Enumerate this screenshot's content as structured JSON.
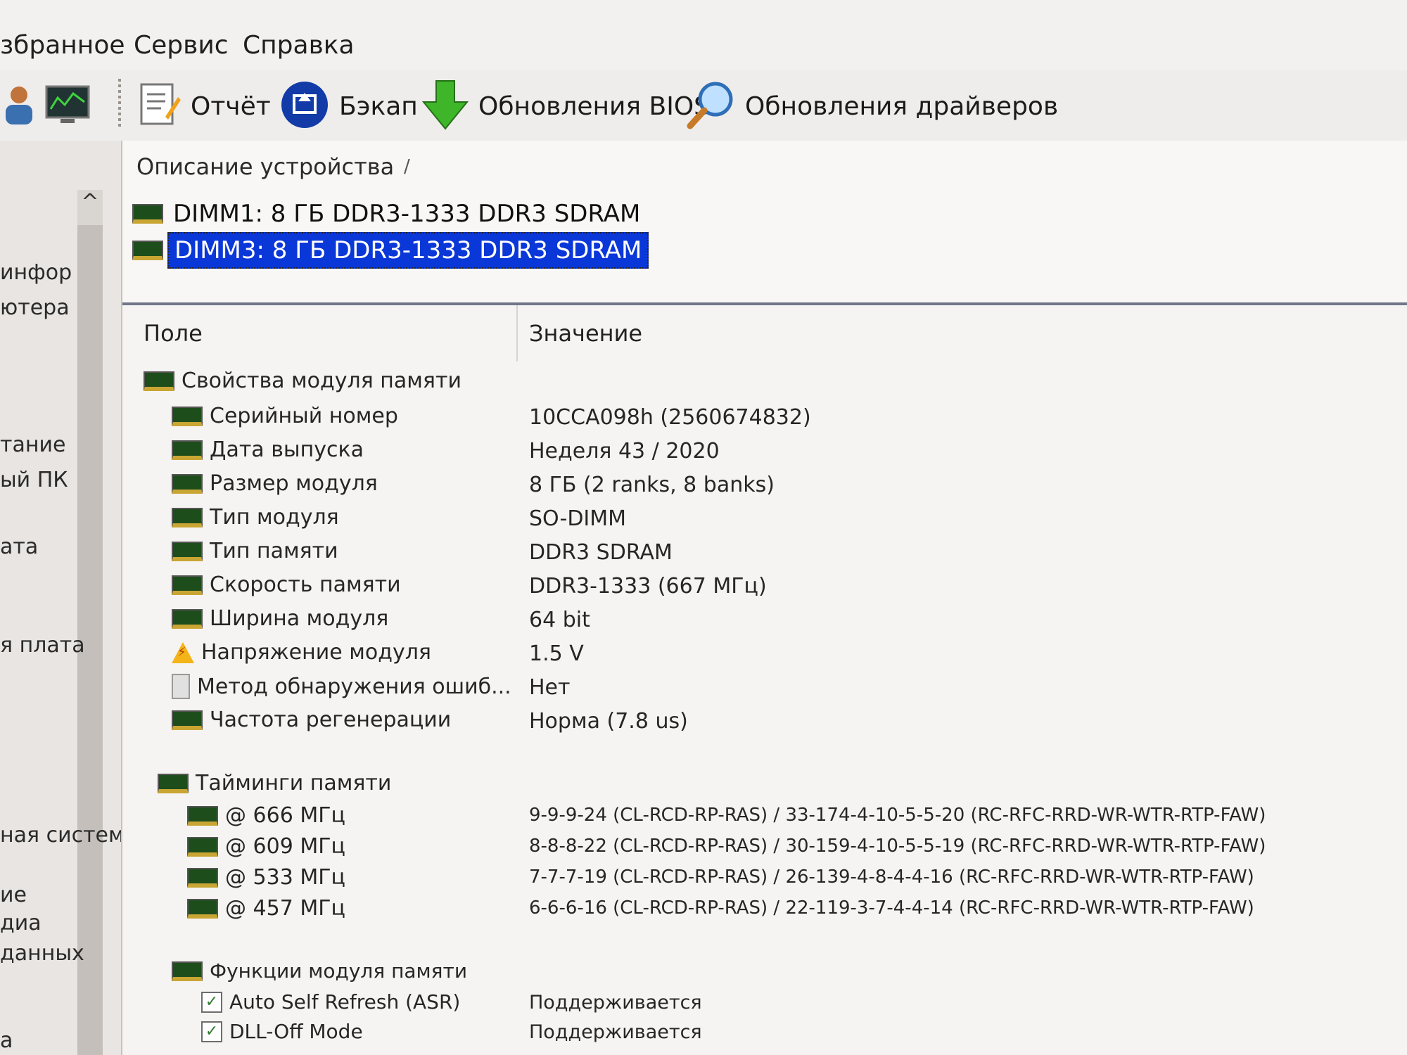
{
  "menubar": {
    "items": [
      "збранное",
      "Сервис",
      "Справка"
    ]
  },
  "toolbar": {
    "report_label": "Отчёт",
    "backup_label": "Бэкап",
    "bios_label": "Обновления BIOS",
    "drivers_label": "Обновления драйверов"
  },
  "sidebar": {
    "scroll_up": "^",
    "items": [
      "инфор",
      "ютера",
      "тание",
      "ый ПК",
      "ата",
      "я плата",
      "ная систем",
      "ие",
      "диа",
      "данных",
      "а"
    ]
  },
  "description": {
    "title": "Описание устройства",
    "slash": "/",
    "devices": [
      "DIMM1: 8 ГБ DDR3-1333 DDR3 SDRAM",
      "DIMM3: 8 ГБ DDR3-1333 DDR3 SDRAM"
    ]
  },
  "table": {
    "col_field": "Поле",
    "col_value": "Значение",
    "group_properties": "Свойства модуля памяти",
    "properties": [
      {
        "field": "Серийный номер",
        "value": "10CCA098h (2560674832)",
        "icon": "ram-chip-icon"
      },
      {
        "field": "Дата выпуска",
        "value": "Неделя 43 / 2020",
        "icon": "ram-chip-icon"
      },
      {
        "field": "Размер модуля",
        "value": "8 ГБ (2 ranks, 8 banks)",
        "icon": "ram-chip-icon"
      },
      {
        "field": "Тип модуля",
        "value": "SO-DIMM",
        "icon": "ram-chip-icon"
      },
      {
        "field": "Тип памяти",
        "value": "DDR3 SDRAM",
        "icon": "ram-chip-icon"
      },
      {
        "field": "Скорость памяти",
        "value": "DDR3-1333 (667 МГц)",
        "icon": "ram-chip-icon"
      },
      {
        "field": "Ширина модуля",
        "value": "64 bit",
        "icon": "ram-chip-icon"
      },
      {
        "field": "Напряжение модуля",
        "value": "1.5 V",
        "icon": "voltage-warning-icon"
      },
      {
        "field": "Метод обнаружения ошиб...",
        "value": "Нет",
        "icon": "document-icon"
      },
      {
        "field": "Частота регенерации",
        "value": "Норма (7.8 us)",
        "icon": "ram-chip-icon"
      }
    ],
    "group_timings": "Тайминги памяти",
    "timings": [
      {
        "field": "@ 666 МГц",
        "value": "9-9-9-24  (CL-RCD-RP-RAS) / 33-174-4-10-5-5-20  (RC-RFC-RRD-WR-WTR-RTP-FAW)"
      },
      {
        "field": "@ 609 МГц",
        "value": "8-8-8-22  (CL-RCD-RP-RAS) / 30-159-4-10-5-5-19  (RC-RFC-RRD-WR-WTR-RTP-FAW)"
      },
      {
        "field": "@ 533 МГц",
        "value": "7-7-7-19  (CL-RCD-RP-RAS) / 26-139-4-8-4-4-16  (RC-RFC-RRD-WR-WTR-RTP-FAW)"
      },
      {
        "field": "@ 457 МГц",
        "value": "6-6-6-16  (CL-RCD-RP-RAS) / 22-119-3-7-4-4-14  (RC-RFC-RRD-WR-WTR-RTP-FAW)"
      }
    ],
    "group_functions": "Функции модуля памяти",
    "functions": [
      {
        "field": "Auto Self Refresh (ASR)",
        "value": "Поддерживается",
        "checked": "✓"
      },
      {
        "field": "DLL-Off Mode",
        "value": "Поддерживается",
        "checked": "✓"
      }
    ]
  }
}
